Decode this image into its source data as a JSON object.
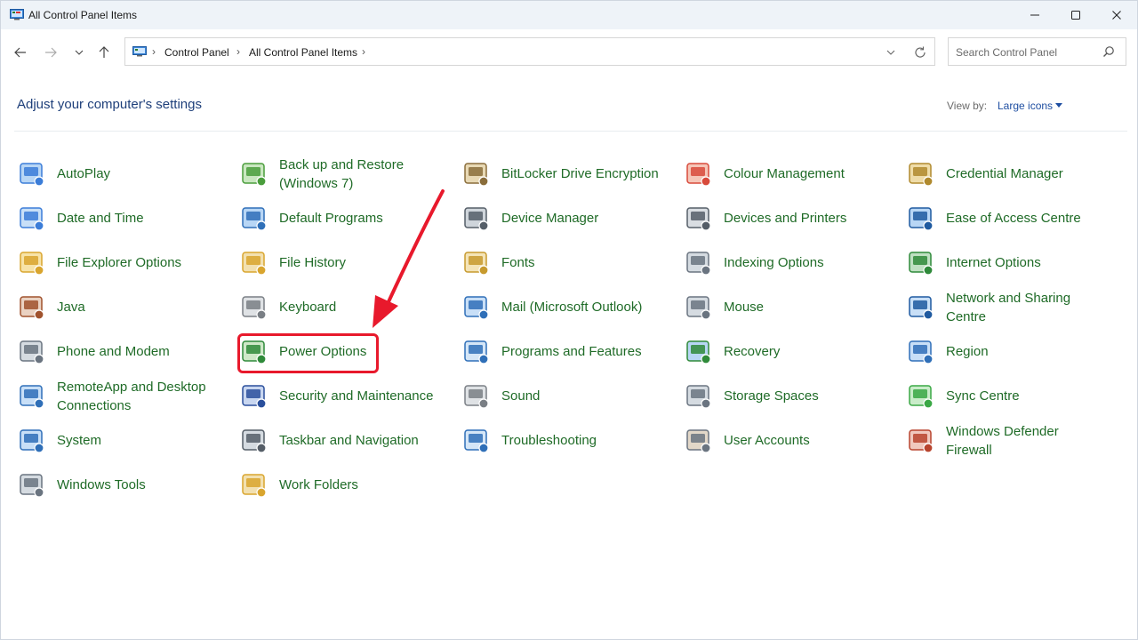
{
  "window": {
    "title": "All Control Panel Items"
  },
  "nav": {
    "breadcrumb": [
      "Control Panel",
      "All Control Panel Items"
    ],
    "search_placeholder": "Search Control Panel"
  },
  "header": {
    "title": "Adjust your computer's settings",
    "view_by_label": "View by:",
    "view_by_value": "Large icons"
  },
  "items": [
    "AutoPlay",
    "Back up and Restore\n(Windows 7)",
    "BitLocker Drive Encryption",
    "Colour Management",
    "Credential Manager",
    "Date and Time",
    "Default Programs",
    "Device Manager",
    "Devices and Printers",
    "Ease of Access Centre",
    "File Explorer Options",
    "File History",
    "Fonts",
    "Indexing Options",
    "Internet Options",
    "Java",
    "Keyboard",
    "Mail (Microsoft Outlook)",
    "Mouse",
    "Network and Sharing\nCentre",
    "Phone and Modem",
    "Power Options",
    "Programs and Features",
    "Recovery",
    "Region",
    "RemoteApp and Desktop\nConnections",
    "Security and Maintenance",
    "Sound",
    "Storage Spaces",
    "Sync Centre",
    "System",
    "Taskbar and Navigation",
    "Troubleshooting",
    "User Accounts",
    "Windows Defender\nFirewall",
    "Windows Tools",
    "Work Folders"
  ],
  "icons": [
    "autoplay-icon",
    "backup-restore-icon",
    "bitlocker-icon",
    "colour-management-icon",
    "credential-manager-icon",
    "date-time-icon",
    "default-programs-icon",
    "device-manager-icon",
    "devices-printers-icon",
    "ease-of-access-icon",
    "file-explorer-options-icon",
    "file-history-icon",
    "fonts-icon",
    "indexing-options-icon",
    "internet-options-icon",
    "java-icon",
    "keyboard-icon",
    "mail-icon",
    "mouse-icon",
    "network-sharing-icon",
    "phone-modem-icon",
    "power-options-icon",
    "programs-features-icon",
    "recovery-icon",
    "region-icon",
    "remoteapp-icon",
    "security-maintenance-icon",
    "sound-icon",
    "storage-spaces-icon",
    "sync-centre-icon",
    "system-icon",
    "taskbar-navigation-icon",
    "troubleshooting-icon",
    "user-accounts-icon",
    "firewall-icon",
    "windows-tools-icon",
    "work-folders-icon"
  ],
  "highlighted_item": "Power Options",
  "colors": {
    "item_text": "#1f6b27",
    "heading": "#1e3f7a",
    "annotation_red": "#e8192c"
  }
}
